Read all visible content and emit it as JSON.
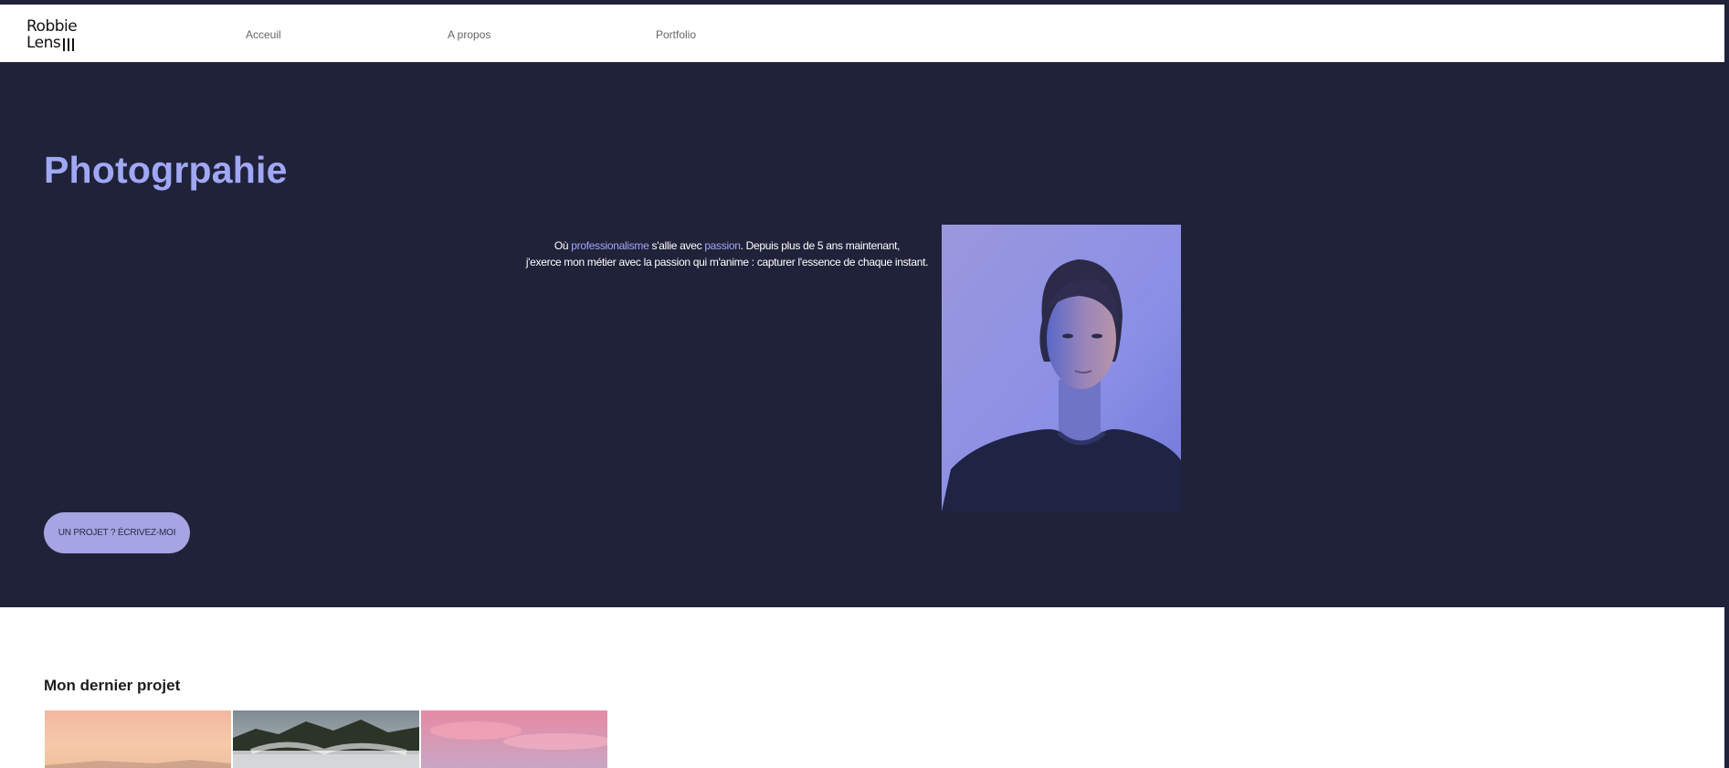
{
  "nav": {
    "logo_line1": "Robbie",
    "logo_line2": "Lens",
    "links": [
      {
        "label": "Acceuil"
      },
      {
        "label": "A propos"
      },
      {
        "label": "Portfolio"
      }
    ]
  },
  "hero": {
    "title": "Photogrpahie",
    "intro": {
      "t1": "Où ",
      "h1": "professionalisme",
      "t2": " s'allie avec ",
      "h2": "passion",
      "t3": ". Depuis plus de 5 ans maintenant,",
      "line2": "j'exerce mon métier avec la passion qui m'anime : capturer l'essence de chaque instant."
    },
    "cta_label": "UN PROJET ? ÉCRIVEZ-MOI"
  },
  "projects": {
    "title": "Mon dernier projet"
  },
  "colors": {
    "background_dark": "#20223a",
    "accent": "#a0a8f4",
    "button_bg": "#a6a4e2"
  }
}
